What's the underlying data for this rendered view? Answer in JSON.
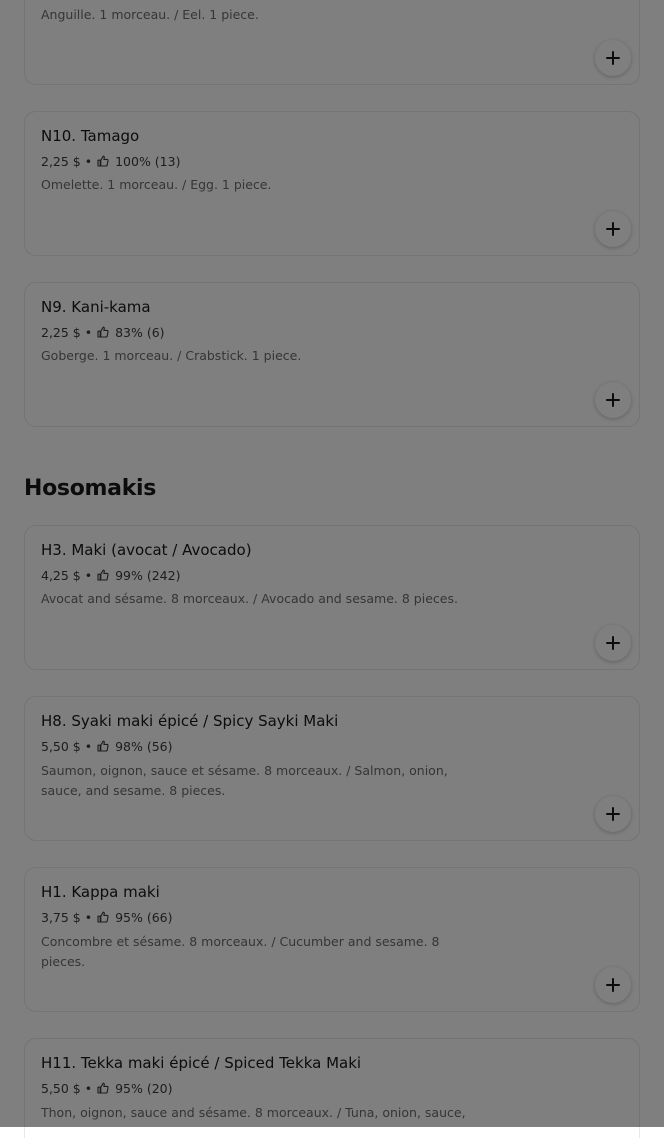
{
  "top_partial": {
    "desc": "Anguille. 1 morceau. / Eel. 1 piece."
  },
  "items_a": [
    {
      "name": "N10. Tamago",
      "price": "2,25 $",
      "sep": "•",
      "rating": "100% (13)",
      "desc": "Omelette. 1 morceau. / Egg. 1 piece."
    },
    {
      "name": "N9. Kani-kama",
      "price": "2,25 $",
      "sep": "•",
      "rating": "83% (6)",
      "desc": "Goberge. 1 morceau. / Crabstick. 1 piece."
    }
  ],
  "section": {
    "title": "Hosomakis"
  },
  "items_b": [
    {
      "name": "H3. Maki (avocat / Avocado)",
      "price": "4,25 $",
      "sep": "•",
      "rating": "99% (242)",
      "desc": "Avocat and sésame. 8 morceaux. / Avocado and sesame. 8 pieces."
    },
    {
      "name": "H8. Syaki maki épicé / Spicy Sayki Maki",
      "price": "5,50 $",
      "sep": "•",
      "rating": "98% (56)",
      "desc": "Saumon, oignon, sauce et sésame. 8 morceaux. / Salmon, onion, sauce, and sesame. 8 pieces."
    },
    {
      "name": "H1. Kappa maki",
      "price": "3,75 $",
      "sep": "•",
      "rating": "95% (66)",
      "desc": "Concombre et sésame. 8 morceaux. / Cucumber and sesame. 8 pieces."
    },
    {
      "name": "H11. Tekka maki épicé / Spiced Tekka Maki",
      "price": "5,50 $",
      "sep": "•",
      "rating": "95% (20)",
      "desc": "Thon, oignon, sauce and sésame. 8 morceaux. / Tuna, onion, sauce,"
    }
  ],
  "icons": {
    "add": "plus-icon",
    "rating": "thumbs-up-icon"
  },
  "colors": {
    "overlay": "#000000",
    "text": "#191919",
    "muted": "#6b6b6b"
  }
}
